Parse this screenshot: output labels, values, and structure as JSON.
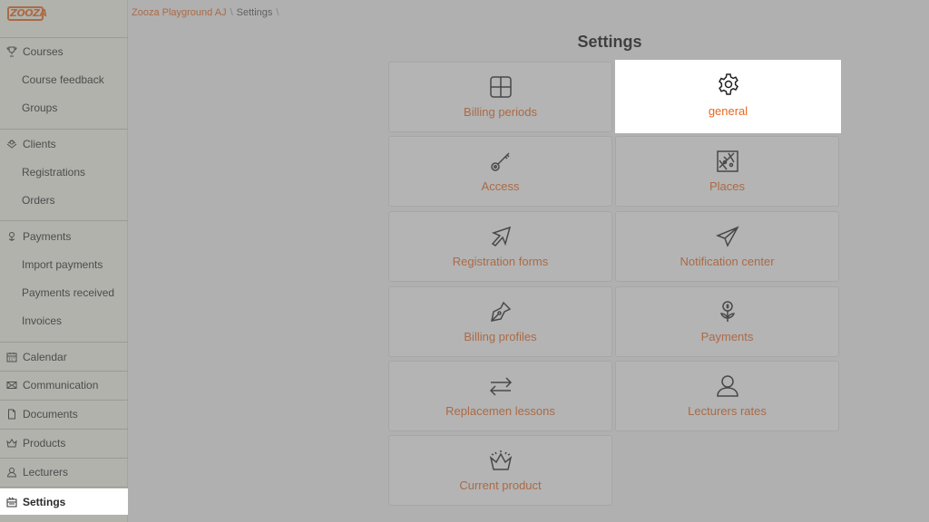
{
  "breadcrumb": {
    "root": "Zooza Playground AJ",
    "sep1": "\\",
    "current": "Settings",
    "sep2": "\\"
  },
  "logo": {
    "text": "ZOOZA"
  },
  "page": {
    "title": "Settings"
  },
  "sidebar": {
    "items": [
      {
        "label": "Courses",
        "icon": "trophy-icon"
      },
      {
        "label": "Course feedback"
      },
      {
        "label": "Groups"
      },
      {
        "label": "Clients",
        "icon": "users-icon"
      },
      {
        "label": "Registrations"
      },
      {
        "label": "Orders"
      },
      {
        "label": "Payments",
        "icon": "money-icon"
      },
      {
        "label": "Import payments"
      },
      {
        "label": "Payments received"
      },
      {
        "label": "Invoices"
      },
      {
        "label": "Calendar",
        "icon": "calendar-icon"
      },
      {
        "label": "Communication",
        "icon": "envelope-icon"
      },
      {
        "label": "Documents",
        "icon": "document-icon"
      },
      {
        "label": "Products",
        "icon": "crown-icon"
      },
      {
        "label": "Lecturers",
        "icon": "user-icon"
      },
      {
        "label": "Settings",
        "icon": "settings-icon"
      }
    ]
  },
  "cards": [
    {
      "label": "Billing periods",
      "icon": "grid-icon"
    },
    {
      "label": "general",
      "icon": "gear-icon"
    },
    {
      "label": "Access",
      "icon": "key-icon"
    },
    {
      "label": "Places",
      "icon": "map-icon"
    },
    {
      "label": "Registration forms",
      "icon": "cursor-arrow-icon"
    },
    {
      "label": "Notification center",
      "icon": "paper-plane-icon"
    },
    {
      "label": "Billing profiles",
      "icon": "pen-nib-icon"
    },
    {
      "label": "Payments",
      "icon": "money-plant-icon"
    },
    {
      "label": "Replacemen lessons",
      "icon": "swap-arrows-icon"
    },
    {
      "label": "Lecturers rates",
      "icon": "person-icon"
    },
    {
      "label": "Current product",
      "icon": "crown-icon"
    }
  ],
  "colors": {
    "accent": "#e8671f",
    "overlay": "#6e6e6e"
  }
}
